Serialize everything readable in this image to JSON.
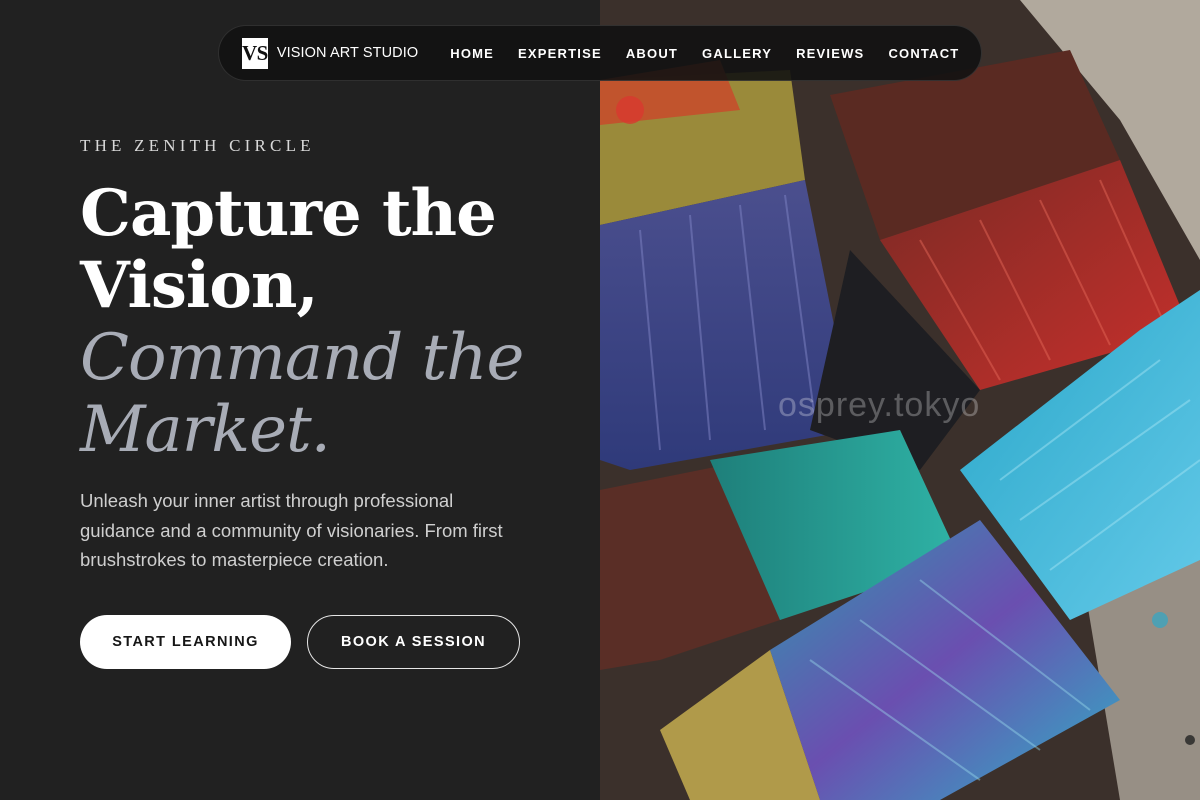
{
  "nav": {
    "logo_mark": "VS",
    "brand_name": "VISION ART STUDIO",
    "items": [
      "HOME",
      "EXPERTISE",
      "ABOUT",
      "GALLERY",
      "REVIEWS",
      "CONTACT"
    ]
  },
  "hero": {
    "eyebrow": "THE ZENITH CIRCLE",
    "headline_line1": "Capture the",
    "headline_line2": "Vision,",
    "headline_line3": "Command the",
    "headline_line4": "Market.",
    "description": "Unleash your inner artist through professional guidance and a community of visionaries. From first brushstrokes to masterpiece creation.",
    "primary_cta": "START LEARNING",
    "secondary_cta": "BOOK A SESSION"
  },
  "image": {
    "subject": "paint-brushes-photo",
    "watermark": "osprey.tokyo"
  },
  "colors": {
    "background": "#212121",
    "headline": "#ffffff",
    "headline_accent": "#a8acb6",
    "button_primary_bg": "#ffffff"
  }
}
